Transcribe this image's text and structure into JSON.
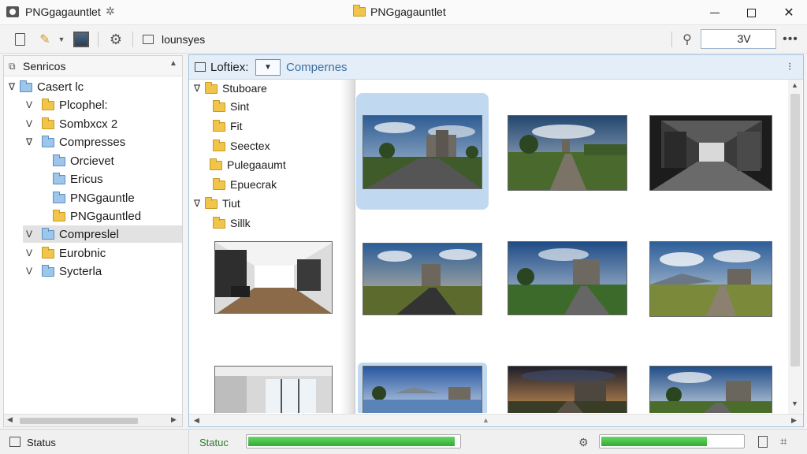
{
  "window": {
    "app_title": "PNGgagauntlet",
    "center_title": "PNGgagauntlet"
  },
  "toolbar": {
    "label": "lounsyes",
    "input_value": "3V"
  },
  "sidebar": {
    "header": "Senricos",
    "items": [
      {
        "label": "Casert lc",
        "arrow": "∇",
        "folder": "blue"
      },
      {
        "label": "Plcophel:",
        "arrow": "V",
        "folder": "yellow"
      },
      {
        "label": "Sombxcx 2",
        "arrow": "V",
        "folder": "yellow"
      },
      {
        "label": "Compresses",
        "arrow": "∇",
        "folder": "blue"
      },
      {
        "label": "Orcievet",
        "arrow": "",
        "folder": "blue"
      },
      {
        "label": "Ericus",
        "arrow": "",
        "folder": "blue"
      },
      {
        "label": "PNGgauntle",
        "arrow": "",
        "folder": "blue"
      },
      {
        "label": "PNGgauntled",
        "arrow": "",
        "folder": "yellow"
      },
      {
        "label": "Compreslel",
        "arrow": "V",
        "folder": "blue",
        "selected": true
      },
      {
        "label": "Eurobnic",
        "arrow": "V",
        "folder": "yellow"
      },
      {
        "label": "Sycterla",
        "arrow": "V",
        "folder": "blue"
      }
    ]
  },
  "main": {
    "header_label": "Loftiex:",
    "header_label2": "Compernes",
    "inner_tree": [
      {
        "label": "Stuboare",
        "arrow": "∇"
      },
      {
        "label": "Sint",
        "arrow": ""
      },
      {
        "label": "Fit",
        "arrow": ""
      },
      {
        "label": "Seectex",
        "arrow": ""
      },
      {
        "label": "Pulegaaumt",
        "arrow": ""
      },
      {
        "label": "Epuecrak",
        "arrow": ""
      },
      {
        "label": "Tiut",
        "arrow": "∇"
      },
      {
        "label": "Sillk",
        "arrow": ""
      }
    ]
  },
  "status": {
    "left_label": "Status",
    "right_label": "Statuc",
    "progress1": 0.98,
    "progress2": 0.75
  },
  "colors": {
    "accent": "#9fc2e2",
    "selection": "#c0d9f1",
    "progress_green": "#2fae2f",
    "folder_yellow": "#f1c54a",
    "folder_blue": "#9ec5ea"
  }
}
